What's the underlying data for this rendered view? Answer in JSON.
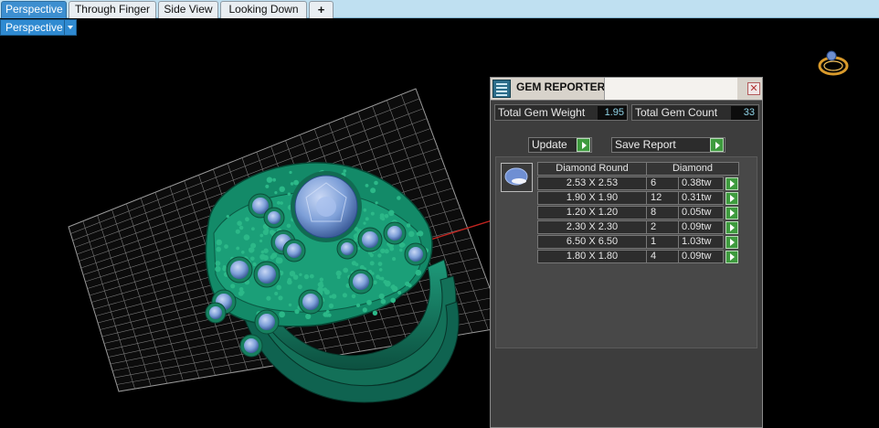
{
  "tabs": [
    {
      "label": "Perspective",
      "active": true
    },
    {
      "label": "Through Finger",
      "active": false
    },
    {
      "label": "Side View",
      "active": false
    },
    {
      "label": "Looking Down",
      "active": false
    },
    {
      "label": "+",
      "active": false
    }
  ],
  "view_selector": {
    "label": "Perspective"
  },
  "viewport": {
    "content": "3D ring model with gems on a grid floor",
    "model_color": "#15745e",
    "gem_color": "#7d9fd8"
  },
  "gem_reporter": {
    "title": "GEM REPORTER",
    "total_weight_label": "Total Gem Weight",
    "total_weight_value": "1.95",
    "total_count_label": "Total Gem Count",
    "total_count_value": "33",
    "update_label": "Update",
    "save_report_label": "Save Report",
    "table": {
      "headers": [
        "Diamond Round",
        "Diamond"
      ],
      "rows": [
        {
          "size": "2.53 X 2.53",
          "count": "6",
          "weight": "0.38tw"
        },
        {
          "size": "1.90 X 1.90",
          "count": "12",
          "weight": "0.31tw"
        },
        {
          "size": "1.20 X 1.20",
          "count": "8",
          "weight": "0.05tw"
        },
        {
          "size": "2.30 X 2.30",
          "count": "2",
          "weight": "0.09tw"
        },
        {
          "size": "6.50 X 6.50",
          "count": "1",
          "weight": "1.03tw"
        },
        {
          "size": "1.80 X 1.80",
          "count": "4",
          "weight": "0.09tw"
        }
      ]
    }
  }
}
